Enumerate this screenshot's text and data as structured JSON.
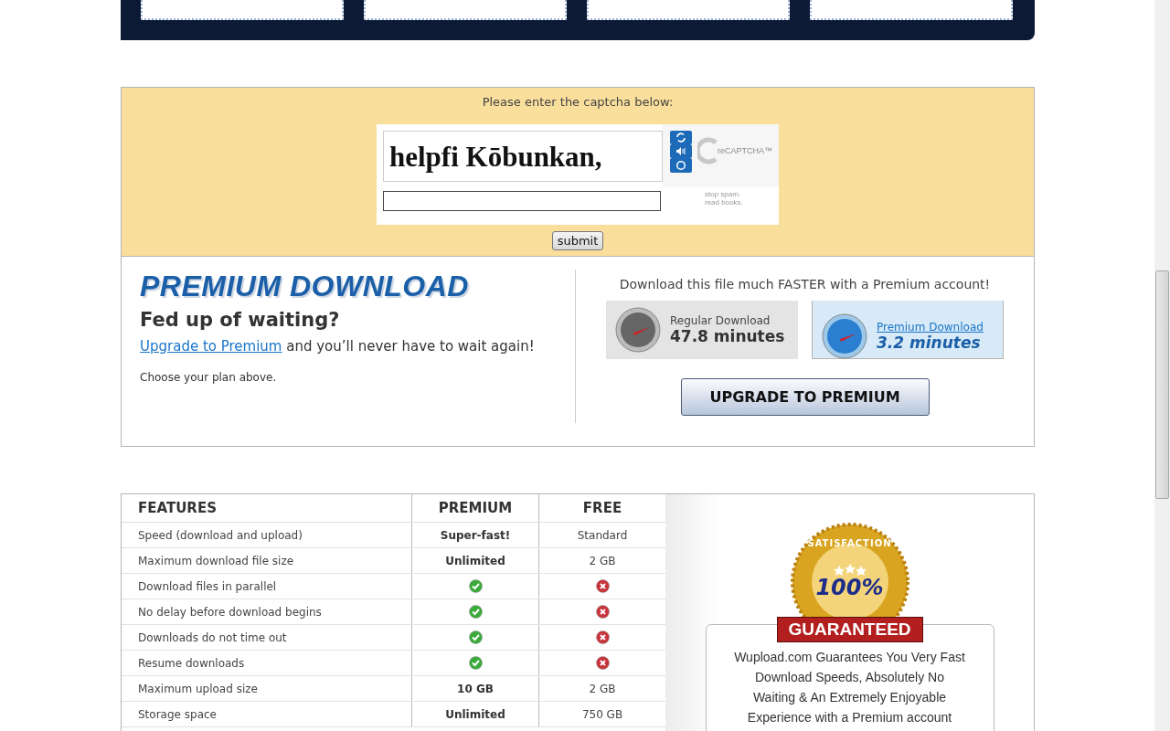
{
  "captcha": {
    "prompt": "Please enter the captcha below:",
    "challenge": "helpfi Kōbunkan,",
    "logo": "reCAPTCHA™",
    "tagline": [
      "stop spam.",
      "read books."
    ],
    "submit": "submit"
  },
  "premium": {
    "title": "PREMIUM DOWNLOAD",
    "heading": "Fed up of waiting?",
    "upgrade_link": "Upgrade to Premium",
    "upgrade_rest": " and you’ll never have to wait again!",
    "note": "Choose your plan above.",
    "faster": "Download this file much FASTER with a Premium account!",
    "speeds": [
      {
        "kind": "regular",
        "label": "Regular Download",
        "time": "47.8 minutes"
      },
      {
        "kind": "premium",
        "label": "Premium Download",
        "time": "3.2 minutes"
      }
    ],
    "button": "UPGRADE TO PREMIUM"
  },
  "features": {
    "columns": [
      "FEATURES",
      "PREMIUM",
      "FREE"
    ],
    "rows": [
      {
        "feature": "Speed (download and upload)",
        "premium": {
          "kind": "text",
          "text": "Super-fast!"
        },
        "free": {
          "kind": "text",
          "text": "Standard"
        }
      },
      {
        "feature": "Maximum download file size",
        "premium": {
          "kind": "text",
          "text": "Unlimited"
        },
        "free": {
          "kind": "text",
          "text": "2 GB"
        }
      },
      {
        "feature": "Download files in parallel",
        "premium": {
          "kind": "check",
          "available": true
        },
        "free": {
          "kind": "check",
          "available": false
        }
      },
      {
        "feature": "No delay before download begins",
        "premium": {
          "kind": "check",
          "available": true
        },
        "free": {
          "kind": "check",
          "available": false
        }
      },
      {
        "feature": "Downloads do not time out",
        "premium": {
          "kind": "check",
          "available": true
        },
        "free": {
          "kind": "check",
          "available": false
        }
      },
      {
        "feature": "Resume downloads",
        "premium": {
          "kind": "check",
          "available": true
        },
        "free": {
          "kind": "check",
          "available": false
        }
      },
      {
        "feature": "Maximum upload size",
        "premium": {
          "kind": "text",
          "text": "10 GB"
        },
        "free": {
          "kind": "text",
          "text": "2 GB"
        }
      },
      {
        "feature": "Storage space",
        "premium": {
          "kind": "text",
          "text": "Unlimited"
        },
        "free": {
          "kind": "text",
          "text": "750 GB"
        }
      }
    ]
  },
  "guarantee": {
    "seal_arc": "SATISFACTION",
    "seal_percent": "100%",
    "seal_ribbon": "GUARANTEED",
    "text": "Wupload.com Guarantees You Very Fast Download Speeds, Absolutely No Waiting & An Extremely Enjoyable Experience with a Premium account"
  }
}
